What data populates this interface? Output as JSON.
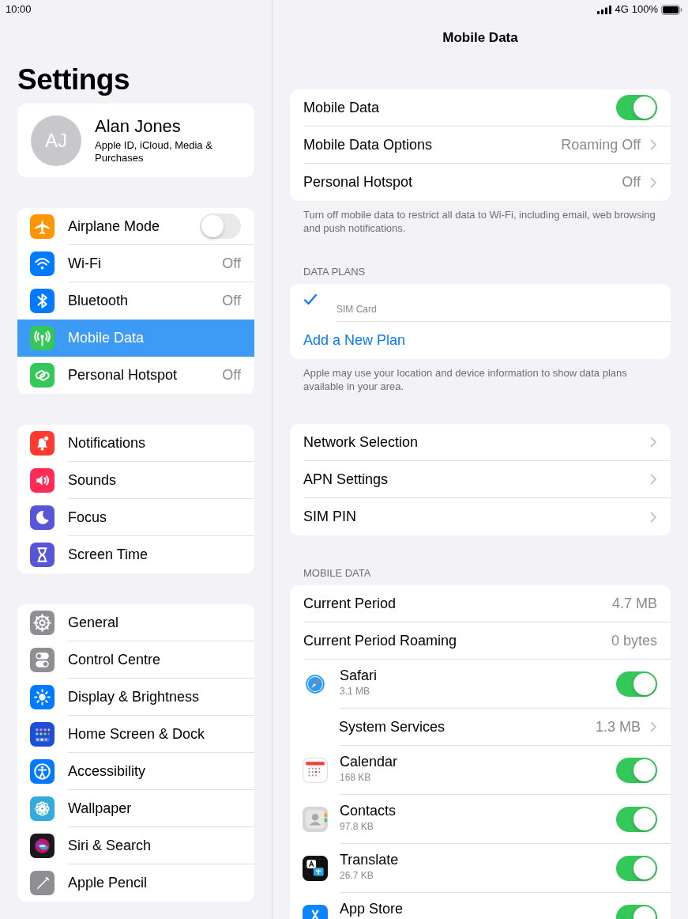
{
  "status_bar": {
    "time": "10:00",
    "network": "4G",
    "battery": "100%"
  },
  "sidebar": {
    "title": "Settings",
    "profile": {
      "initials": "AJ",
      "name": "Alan Jones",
      "subtitle": "Apple ID, iCloud, Media & Purchases"
    },
    "groups": [
      {
        "items": [
          {
            "label": "Airplane Mode",
            "kind": "toggle",
            "on": false,
            "selected": false
          },
          {
            "label": "Wi-Fi",
            "kind": "value",
            "value": "Off",
            "selected": false
          },
          {
            "label": "Bluetooth",
            "kind": "value",
            "value": "Off",
            "selected": false
          },
          {
            "label": "Mobile Data",
            "kind": "nav",
            "selected": true
          },
          {
            "label": "Personal Hotspot",
            "kind": "value",
            "value": "Off",
            "selected": false
          }
        ]
      },
      {
        "items": [
          {
            "label": "Notifications",
            "kind": "nav",
            "selected": false
          },
          {
            "label": "Sounds",
            "kind": "nav",
            "selected": false
          },
          {
            "label": "Focus",
            "kind": "nav",
            "selected": false
          },
          {
            "label": "Screen Time",
            "kind": "nav",
            "selected": false
          }
        ]
      },
      {
        "items": [
          {
            "label": "General",
            "kind": "nav",
            "selected": false
          },
          {
            "label": "Control Centre",
            "kind": "nav",
            "selected": false
          },
          {
            "label": "Display & Brightness",
            "kind": "nav",
            "selected": false
          },
          {
            "label": "Home Screen & Dock",
            "kind": "nav",
            "selected": false
          },
          {
            "label": "Accessibility",
            "kind": "nav",
            "selected": false
          },
          {
            "label": "Wallpaper",
            "kind": "nav",
            "selected": false
          },
          {
            "label": "Siri & Search",
            "kind": "nav",
            "selected": false
          },
          {
            "label": "Apple Pencil",
            "kind": "nav",
            "selected": false
          }
        ]
      }
    ]
  },
  "detail": {
    "title": "Mobile Data",
    "sections": [
      {
        "rows": [
          {
            "kind": "toggle",
            "label": "Mobile Data",
            "on": true
          },
          {
            "kind": "nav",
            "label": "Mobile Data Options",
            "value": "Roaming Off"
          },
          {
            "kind": "nav",
            "label": "Personal Hotspot",
            "value": "Off"
          }
        ],
        "footer": "Turn off mobile data to restrict all data to Wi-Fi, including email, web browsing and push notifications."
      },
      {
        "header": "DATA PLANS",
        "rows": [
          {
            "kind": "plan",
            "label": "SIM Card",
            "selected": true
          },
          {
            "kind": "link",
            "label": "Add a New Plan"
          }
        ],
        "footer": "Apple may use your location and device information to show data plans available in your area."
      },
      {
        "rows": [
          {
            "kind": "nav",
            "label": "Network Selection"
          },
          {
            "kind": "nav",
            "label": "APN Settings"
          },
          {
            "kind": "nav",
            "label": "SIM PIN"
          }
        ]
      },
      {
        "header": "MOBILE DATA",
        "rows": [
          {
            "kind": "value",
            "label": "Current Period",
            "value": "4.7 MB"
          },
          {
            "kind": "value",
            "label": "Current Period Roaming",
            "value": "0 bytes"
          },
          {
            "kind": "app",
            "label": "Safari",
            "detail": "3.1 MB",
            "on": true
          },
          {
            "kind": "subnav",
            "label": "System Services",
            "value": "1.3 MB"
          },
          {
            "kind": "app",
            "label": "Calendar",
            "detail": "168 KB",
            "on": true
          },
          {
            "kind": "app",
            "label": "Contacts",
            "detail": "97.8 KB",
            "on": true
          },
          {
            "kind": "app",
            "label": "Translate",
            "detail": "26.7 KB",
            "on": true
          },
          {
            "kind": "app",
            "label": "App Store",
            "on": true
          }
        ]
      }
    ]
  }
}
